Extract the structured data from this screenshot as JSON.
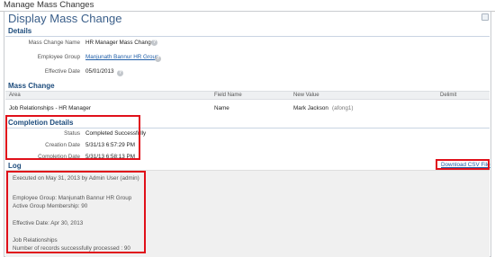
{
  "page": {
    "title": "Manage Mass Changes"
  },
  "panel": {
    "title": "Display Mass Change"
  },
  "details": {
    "heading": "Details",
    "fields": [
      {
        "label": "Mass Change Name",
        "value": "HR Manager Mass Change"
      },
      {
        "label": "Employee Group",
        "value": "Manjunath Bannur HR Group"
      },
      {
        "label": "Effective Date",
        "value": "05/01/2013"
      }
    ]
  },
  "mass_change": {
    "heading": "Mass Change",
    "columns": [
      "Area",
      "Field Name",
      "New Value",
      "Delimit"
    ],
    "rows": [
      {
        "area": "Job Relationships - HR Manager",
        "field_name": "Name",
        "new_value": "Mark Jackson",
        "new_value_id": "(afong1)",
        "delimit": ""
      }
    ]
  },
  "completion": {
    "heading": "Completion Details",
    "fields": [
      {
        "label": "Status",
        "value": "Completed Successfully"
      },
      {
        "label": "Creation Date",
        "value": "5/31/13 6:57:29 PM"
      },
      {
        "label": "Completion Date",
        "value": "5/31/13 6:58:13 PM"
      }
    ]
  },
  "log": {
    "heading": "Log",
    "download_label": "Download CSV File",
    "lines": [
      "Executed on May 31, 2013 by Admin User (admin)",
      "",
      "Employee Group: Manjunath Bannur HR Group",
      "Active Group Membership: 90",
      "",
      "Effective Date: Apr 30, 2013",
      "",
      "Job Relationships",
      "Number of records successfully processed : 90"
    ]
  },
  "colors": {
    "highlight": "#e0101a",
    "heading": "#1c4b7c",
    "link": "#1f5ea8"
  },
  "icons": {
    "help": "help-icon"
  }
}
